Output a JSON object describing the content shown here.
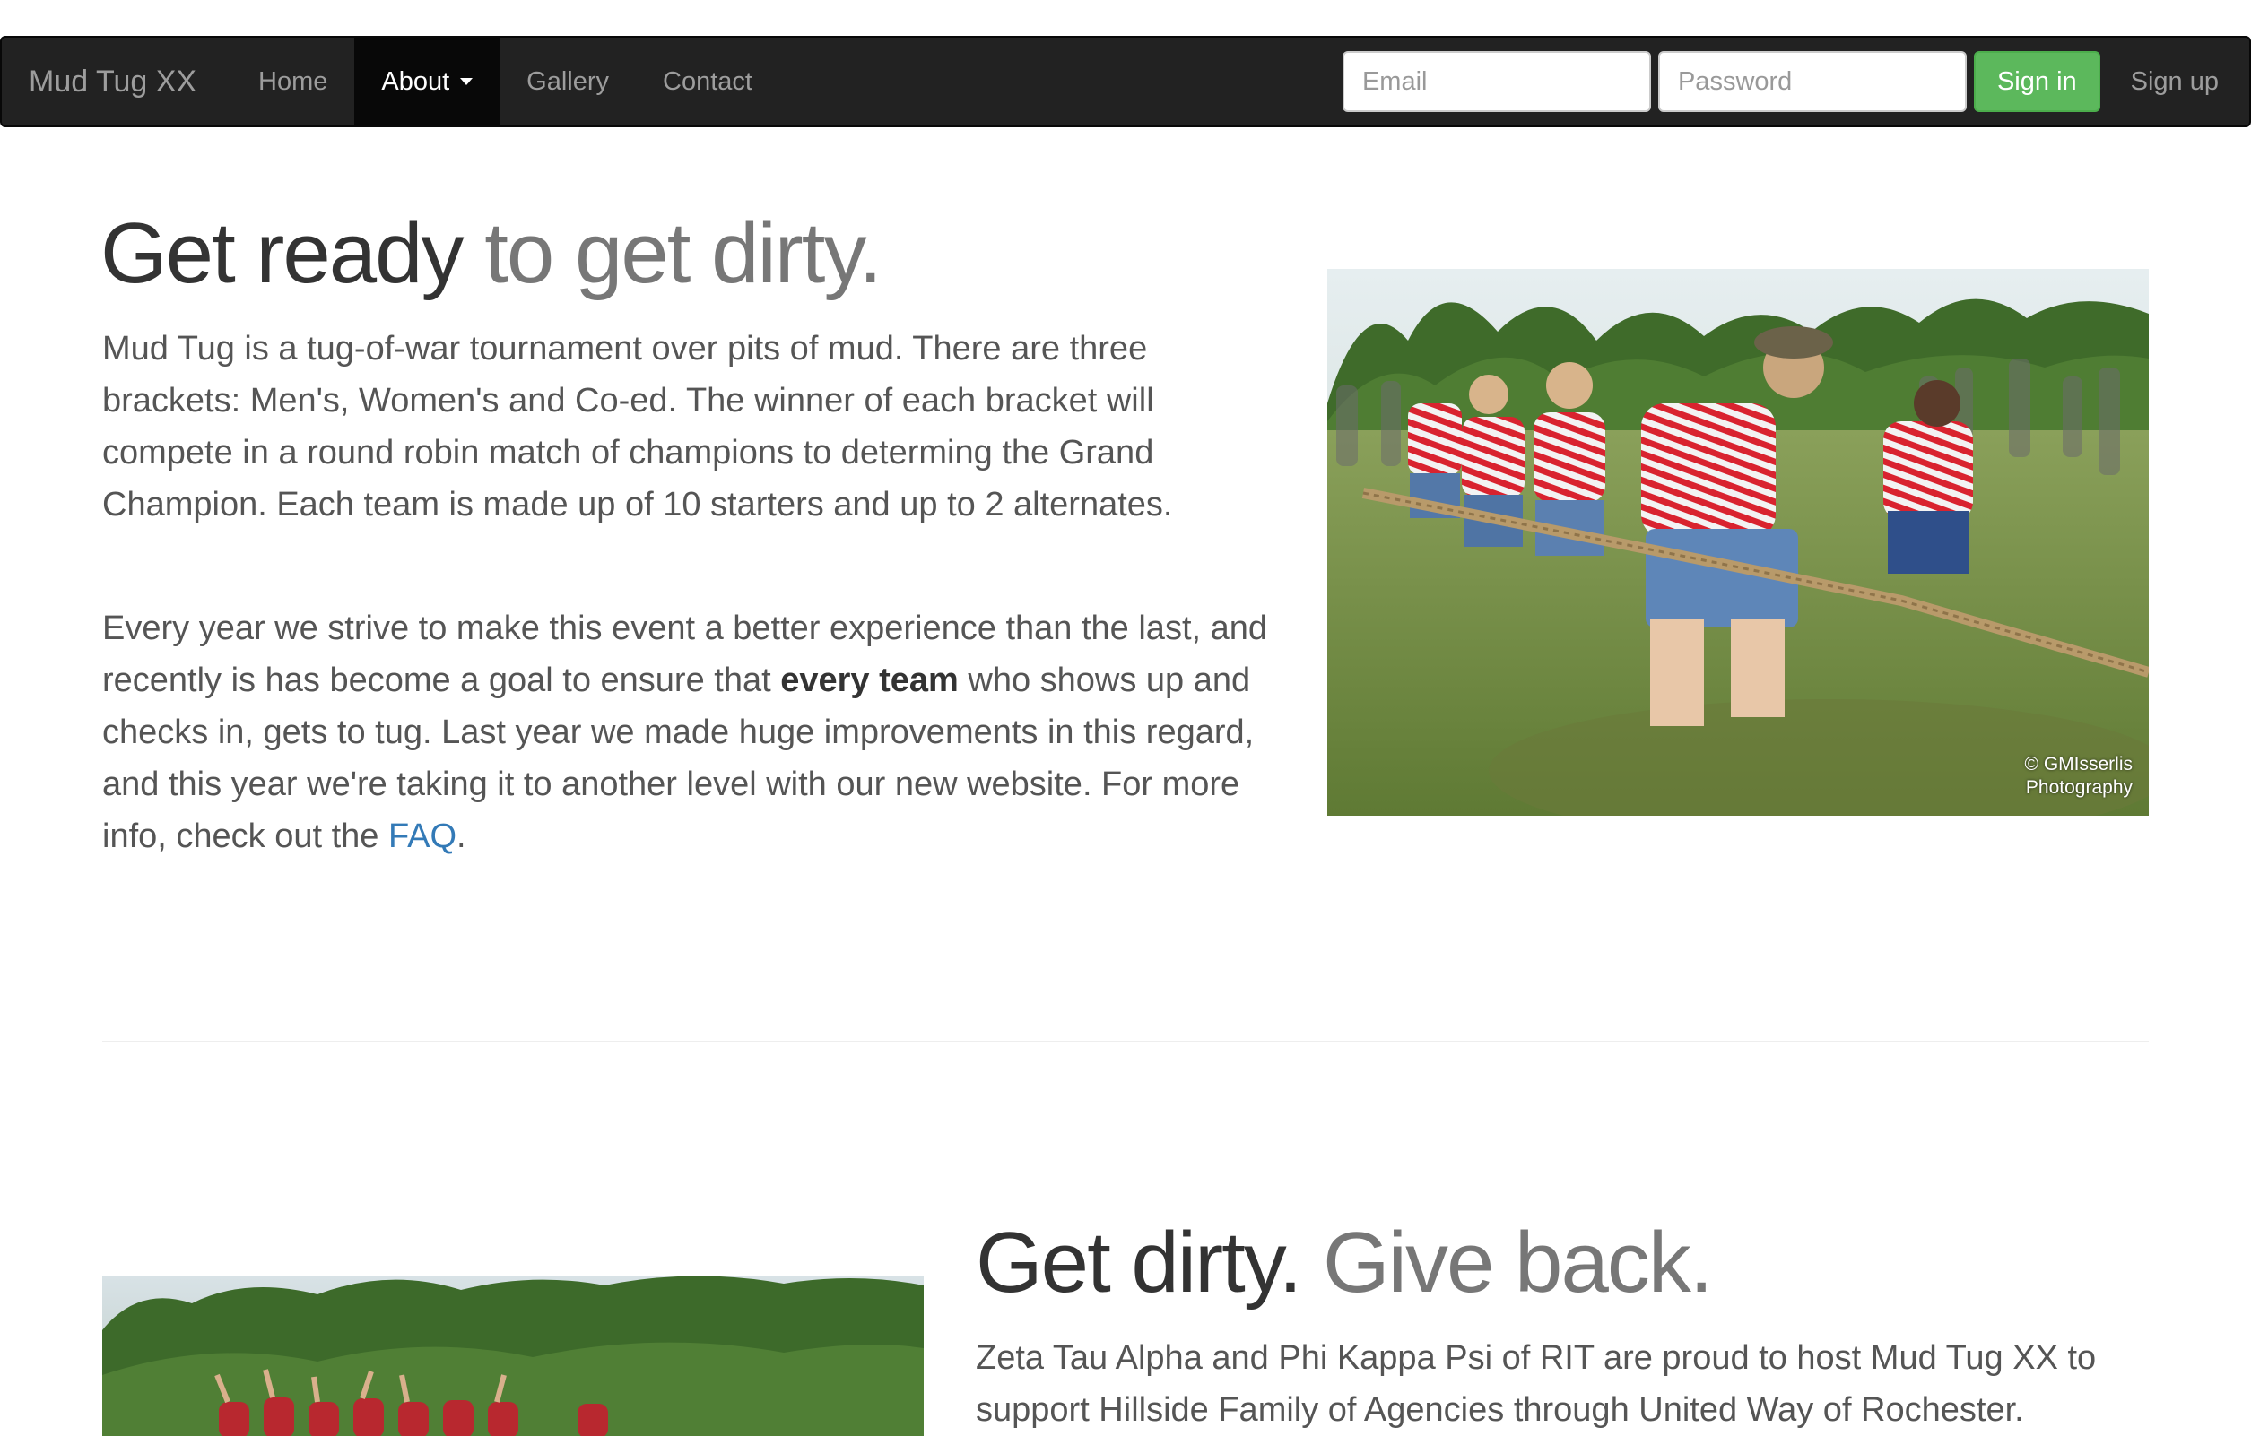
{
  "navbar": {
    "brand": "Mud Tug XX",
    "items": [
      {
        "label": "Home"
      },
      {
        "label": "About"
      },
      {
        "label": "Gallery"
      },
      {
        "label": "Contact"
      }
    ],
    "email_placeholder": "Email",
    "password_placeholder": "Password",
    "signin_label": "Sign in",
    "signup_label": "Sign up"
  },
  "section1": {
    "heading_main": "Get ready",
    "heading_muted": " to get dirty.",
    "p1": "Mud Tug is a tug-of-war tournament over pits of mud. There are three brackets: Men's, Women's and Co-ed. The winner of each bracket will compete in a round robin match of champions to determing the Grand Champion. Each team is made up of 10 starters and up to 2 alternates.",
    "p2_before": "Every year we strive to make this event a better experience than the last, and recently is has become a goal to ensure that ",
    "p2_bold": "every team",
    "p2_after": " who shows up and checks in, gets to tug. Last year we made huge improvements in this regard, and this year we're taking it to another level with our new website. For more info, check out the ",
    "p2_link": "FAQ",
    "p2_end": ".",
    "photo_credit_line1": "© GMIsserlis",
    "photo_credit_line2": "Photography"
  },
  "section2": {
    "heading_main": "Get dirty.",
    "heading_muted": " Give back.",
    "p1": "Zeta Tau Alpha and Phi Kappa Psi of RIT are proud to host Mud Tug XX to support Hillside Family of Agencies through United Way of Rochester."
  },
  "colors": {
    "navbar_bg": "#222222",
    "active_bg": "#080808",
    "success": "#5cb85c",
    "link": "#337ab7"
  }
}
